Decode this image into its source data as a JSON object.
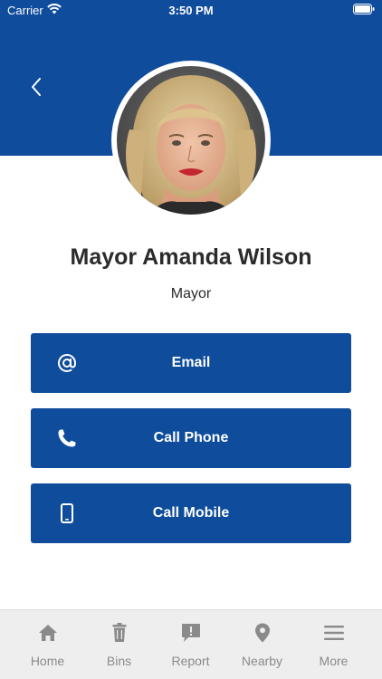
{
  "status_bar": {
    "carrier": "Carrier",
    "time": "3:50 PM"
  },
  "header": {
    "back_icon": "chevron-left-icon",
    "color": "#0f4c9c"
  },
  "profile": {
    "name": "Mayor Amanda Wilson",
    "title": "Mayor"
  },
  "actions": [
    {
      "label": "Email",
      "icon": "at-icon"
    },
    {
      "label": "Call Phone",
      "icon": "phone-icon"
    },
    {
      "label": "Call Mobile",
      "icon": "mobile-icon"
    }
  ],
  "tabs": [
    {
      "label": "Home",
      "icon": "home-icon"
    },
    {
      "label": "Bins",
      "icon": "bin-icon"
    },
    {
      "label": "Report",
      "icon": "report-icon"
    },
    {
      "label": "Nearby",
      "icon": "location-pin-icon"
    },
    {
      "label": "More",
      "icon": "menu-icon"
    }
  ],
  "colors": {
    "brand": "#0f4c9c",
    "tab_inactive": "#8a8a8a",
    "tabbar_bg": "#eeeeee"
  }
}
